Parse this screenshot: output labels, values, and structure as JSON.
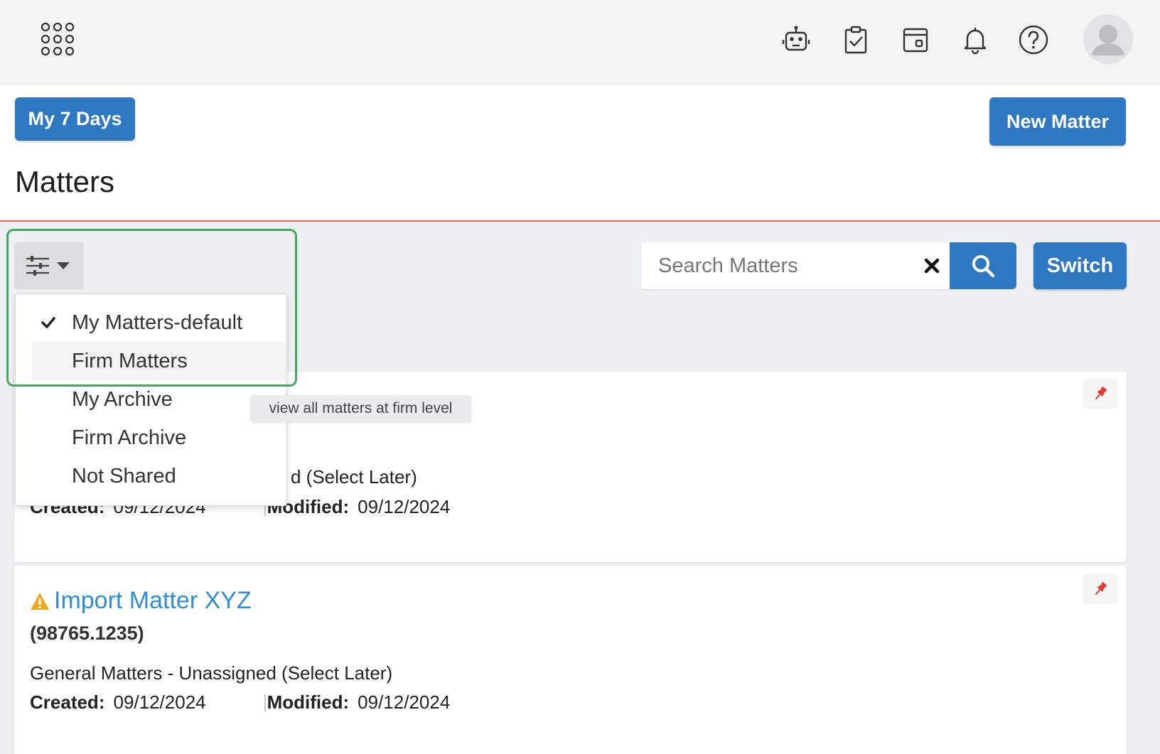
{
  "topbar": {
    "icons": [
      "apps-grid-icon",
      "robot-icon",
      "clipboard-check-icon",
      "calendar-icon",
      "bell-icon",
      "help-icon",
      "avatar-icon"
    ]
  },
  "header": {
    "my7days_label": "My 7 Days",
    "new_matter_label": "New Matter",
    "title": "Matters"
  },
  "toolbar": {
    "search_placeholder": "Search Matters",
    "search_value": "",
    "switch_label": "Switch"
  },
  "dropdown": {
    "items": [
      {
        "label": "My Matters-default",
        "checked": true
      },
      {
        "label": "Firm Matters",
        "checked": false
      },
      {
        "label": "My Archive",
        "checked": false
      },
      {
        "label": "Firm Archive",
        "checked": false
      },
      {
        "label": "Not Shared",
        "checked": false
      }
    ],
    "tooltip": "view all matters at firm level"
  },
  "matters": [
    {
      "category_visible": "d (Select Later)",
      "created_label": "Created:",
      "created": "09/12/2024",
      "modified_label": "Modified:",
      "modified": "09/12/2024"
    },
    {
      "title": "Import Matter XYZ",
      "number": "(98765.1235)",
      "category": "General Matters - Unassigned (Select Later)",
      "created_label": "Created:",
      "created": "09/12/2024",
      "modified_label": "Modified:",
      "modified": "09/12/2024"
    }
  ],
  "colors": {
    "primary": "#2e78c2",
    "link": "#2e8fd6",
    "header_border": "#e9604f",
    "highlight": "#3fab5a",
    "warning": "#f2a71b",
    "pin": "#e53935"
  }
}
